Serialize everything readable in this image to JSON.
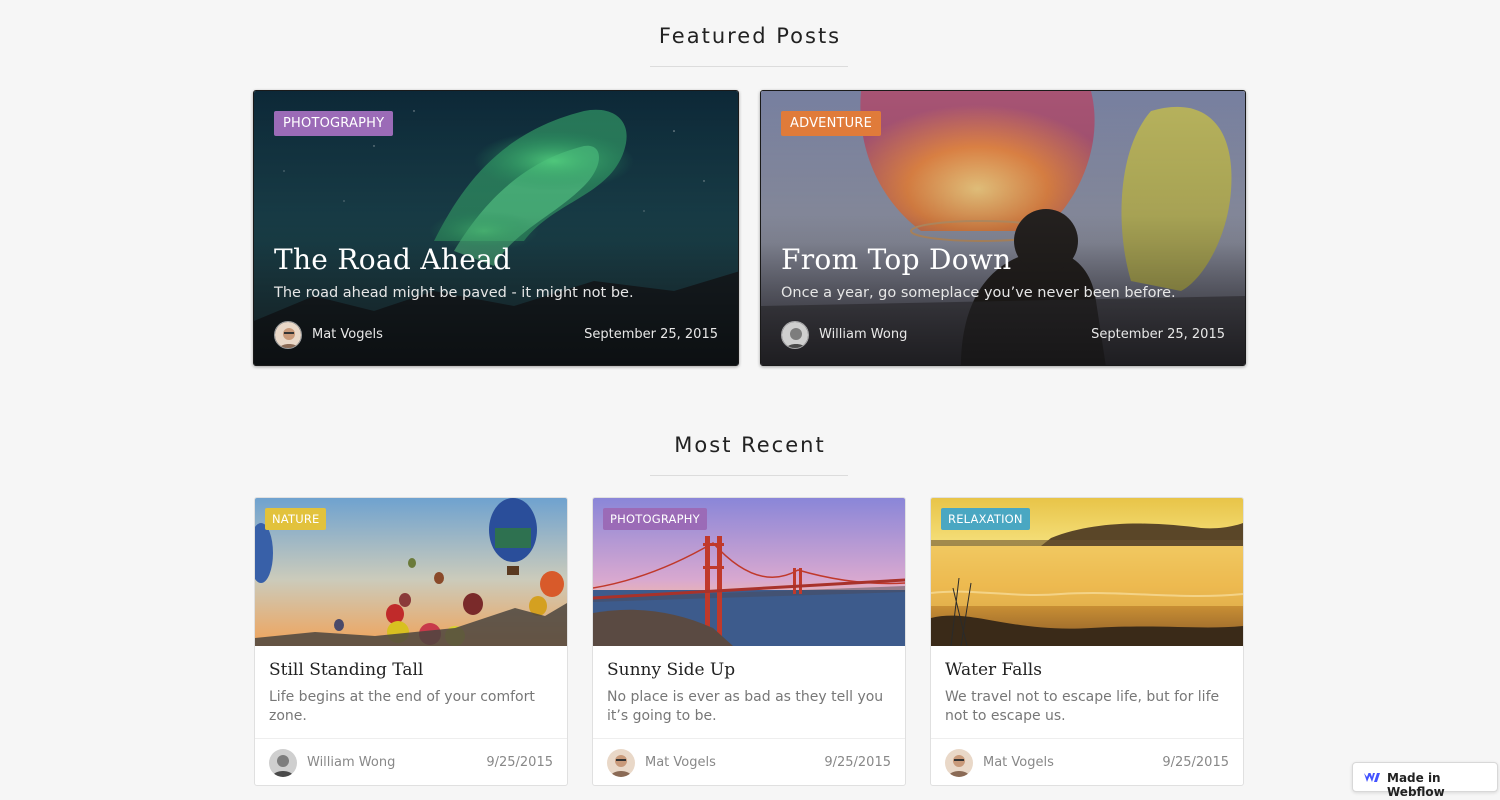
{
  "featured": {
    "title": "Featured Posts",
    "posts": [
      {
        "category": "PHOTOGRAPHY",
        "category_color": "#9b6bb7",
        "title": "The Road Ahead",
        "subtitle": "The road ahead might be paved - it might not be.",
        "author": "Mat Vogels",
        "date": "September 25, 2015"
      },
      {
        "category": "ADVENTURE",
        "category_color": "#e07b3a",
        "title": "From Top Down",
        "subtitle": "Once a year, go someplace you’ve never been before.",
        "author": "William Wong",
        "date": "September 25, 2015"
      }
    ]
  },
  "recent": {
    "title": "Most Recent",
    "posts": [
      {
        "category": "NATURE",
        "category_color": "#e2c23c",
        "title": "Still Standing Tall",
        "subtitle": "Life begins at the end of your comfort zone.",
        "author": "William Wong",
        "date": "9/25/2015"
      },
      {
        "category": "PHOTOGRAPHY",
        "category_color": "#9b6bb7",
        "title": "Sunny Side Up",
        "subtitle": "No place is ever as bad as they tell you it’s going to be.",
        "author": "Mat Vogels",
        "date": "9/25/2015"
      },
      {
        "category": "RELAXATION",
        "category_color": "#4aa7c2",
        "title": "Water Falls",
        "subtitle": "We travel not to escape life, but for life not to escape us.",
        "author": "Mat Vogels",
        "date": "9/25/2015"
      }
    ]
  },
  "badge": {
    "label": "Made in Webflow",
    "icon": "webflow-logo-icon",
    "brand_color": "#4353ff"
  }
}
